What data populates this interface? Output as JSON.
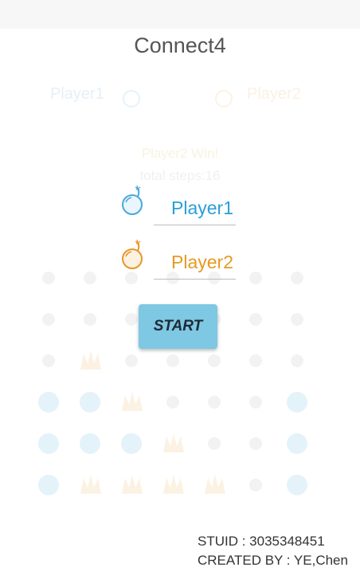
{
  "app": {
    "title": "Connect4"
  },
  "players": {
    "player1_label": "Player1",
    "player2_label": "Player2"
  },
  "result": {
    "win_text": "Player2 Win!",
    "steps_text": "total steps:16"
  },
  "dialog": {
    "player1_value": "Player1",
    "player2_value": "Player2",
    "start_label": "START"
  },
  "footer": {
    "stuid": "STUID : 3035348451",
    "created_by": "CREATED BY : YE,Chen"
  },
  "colors": {
    "player1": "#2a9fd8",
    "player2": "#e79a22",
    "start_button": "#7ec8e3"
  },
  "board": {
    "columns": 7,
    "rows": [
      [
        "",
        "",
        "",
        "",
        "",
        "",
        ""
      ],
      [
        "",
        "",
        "",
        "",
        "",
        "",
        ""
      ],
      [
        "",
        "p2",
        "",
        "",
        "",
        "",
        ""
      ],
      [
        "p1",
        "p1",
        "p2",
        "",
        "",
        "",
        "p1"
      ],
      [
        "p1",
        "p1",
        "p1",
        "p2",
        "",
        "",
        "p1"
      ],
      [
        "p1",
        "p2",
        "p2",
        "p2",
        "p2",
        "",
        "p1"
      ]
    ]
  }
}
